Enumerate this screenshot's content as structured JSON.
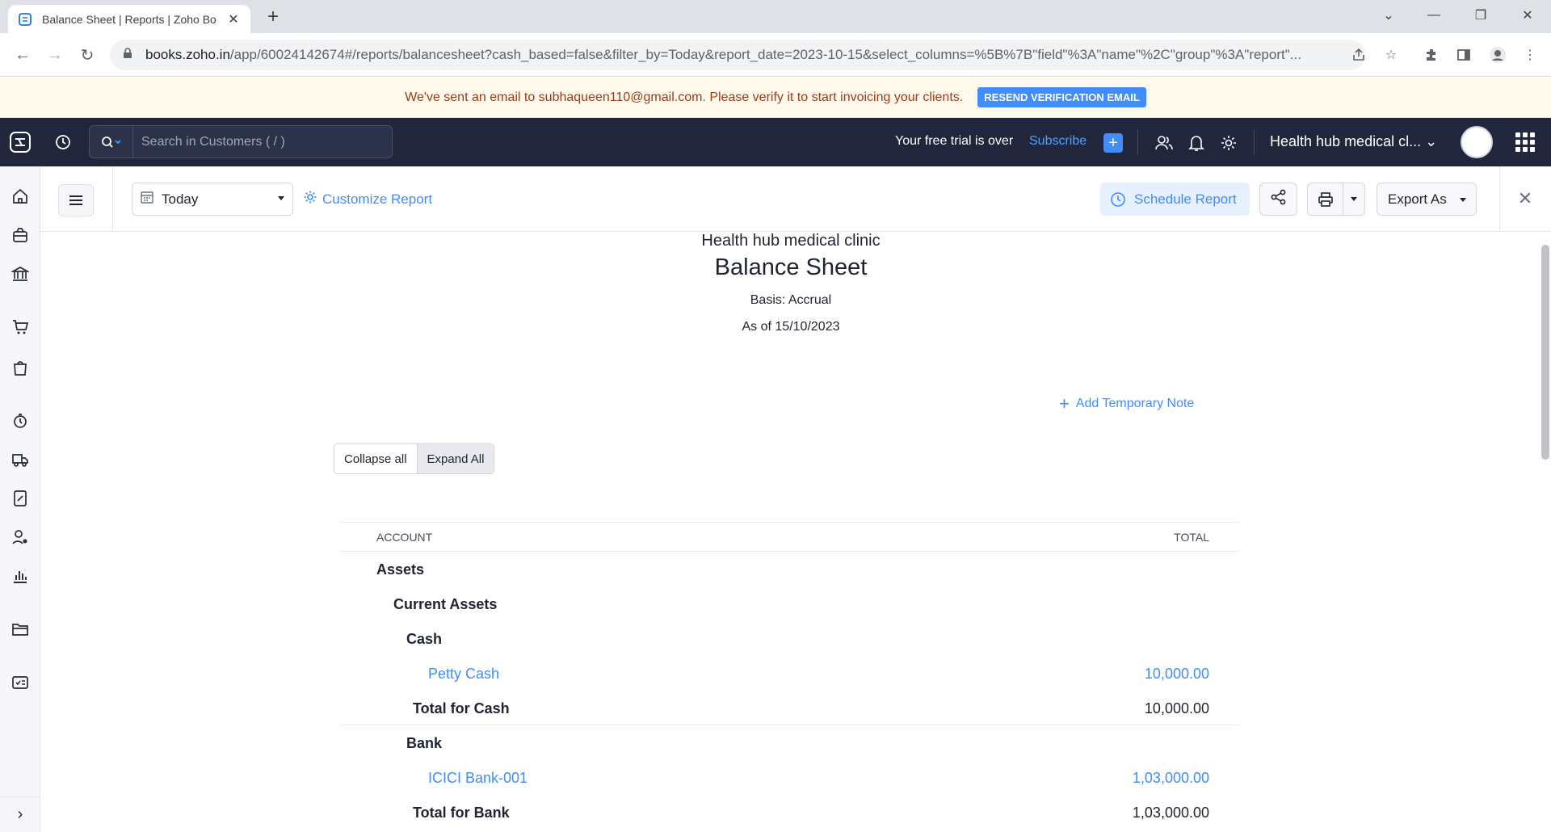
{
  "browser": {
    "tab_title": "Balance Sheet | Reports | Zoho Bo",
    "url_host": "books.zoho.in",
    "url_rest": "/app/60024142674#/reports/balancesheet?cash_based=false&filter_by=Today&report_date=2023-10-15&select_columns=%5B%7B\"field\"%3A\"name\"%2C\"group\"%3A\"report\"..."
  },
  "banner": {
    "message": "We've sent an email to subhaqueen110@gmail.com. Please verify it to start invoicing your clients.",
    "button": "RESEND VERIFICATION EMAIL"
  },
  "header": {
    "search_placeholder": "Search in Customers ( / )",
    "trial_text": "Your free trial is over",
    "subscribe": "Subscribe",
    "org_name": "Health hub medical cl..."
  },
  "toolbar": {
    "date_filter": "Today",
    "customize": "Customize Report",
    "schedule": "Schedule Report",
    "export": "Export As"
  },
  "report": {
    "org": "Health hub medical clinic",
    "title": "Balance Sheet",
    "basis": "Basis: Accrual",
    "as_of": "As of 15/10/2023",
    "add_note": "Add Temporary Note",
    "collapse_all": "Collapse all",
    "expand_all": "Expand All",
    "columns": [
      "ACCOUNT",
      "TOTAL"
    ],
    "rows": [
      {
        "name": "Assets",
        "value": ""
      },
      {
        "name": "Current Assets",
        "value": ""
      },
      {
        "name": "Cash",
        "value": ""
      },
      {
        "name": "Petty Cash",
        "value": "10,000.00"
      },
      {
        "name": "Total for Cash",
        "value": "10,000.00"
      },
      {
        "name": "Bank",
        "value": ""
      },
      {
        "name": "ICICI Bank-001",
        "value": "1,03,000.00"
      },
      {
        "name": "Total for Bank",
        "value": "1,03,000.00"
      }
    ]
  },
  "colors": {
    "accent": "#408dfb",
    "header_bg": "#21263c",
    "banner_bg": "#fffaeb",
    "banner_text": "#9b3b1c"
  }
}
